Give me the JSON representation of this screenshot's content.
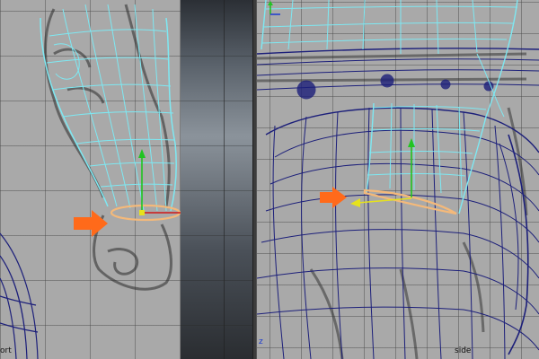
{
  "viewports": {
    "front": {
      "label": "ort"
    },
    "side": {
      "label": "side",
      "axis_label": "z"
    }
  },
  "colors": {
    "wireframe_selected": "#7ee8f2",
    "wireframe_body": "#1c1f7a",
    "arrow_marker": "#ff6a1a",
    "edge_loop": "#f4b97a",
    "manip_y": "#22c422",
    "manip_x": "#d01818",
    "manip_z": "#e6e21c"
  },
  "icons": {
    "marker": "orange-arrow-icon",
    "manipulator": "move-manipulator-icon",
    "axis": "axis-indicator-icon"
  }
}
